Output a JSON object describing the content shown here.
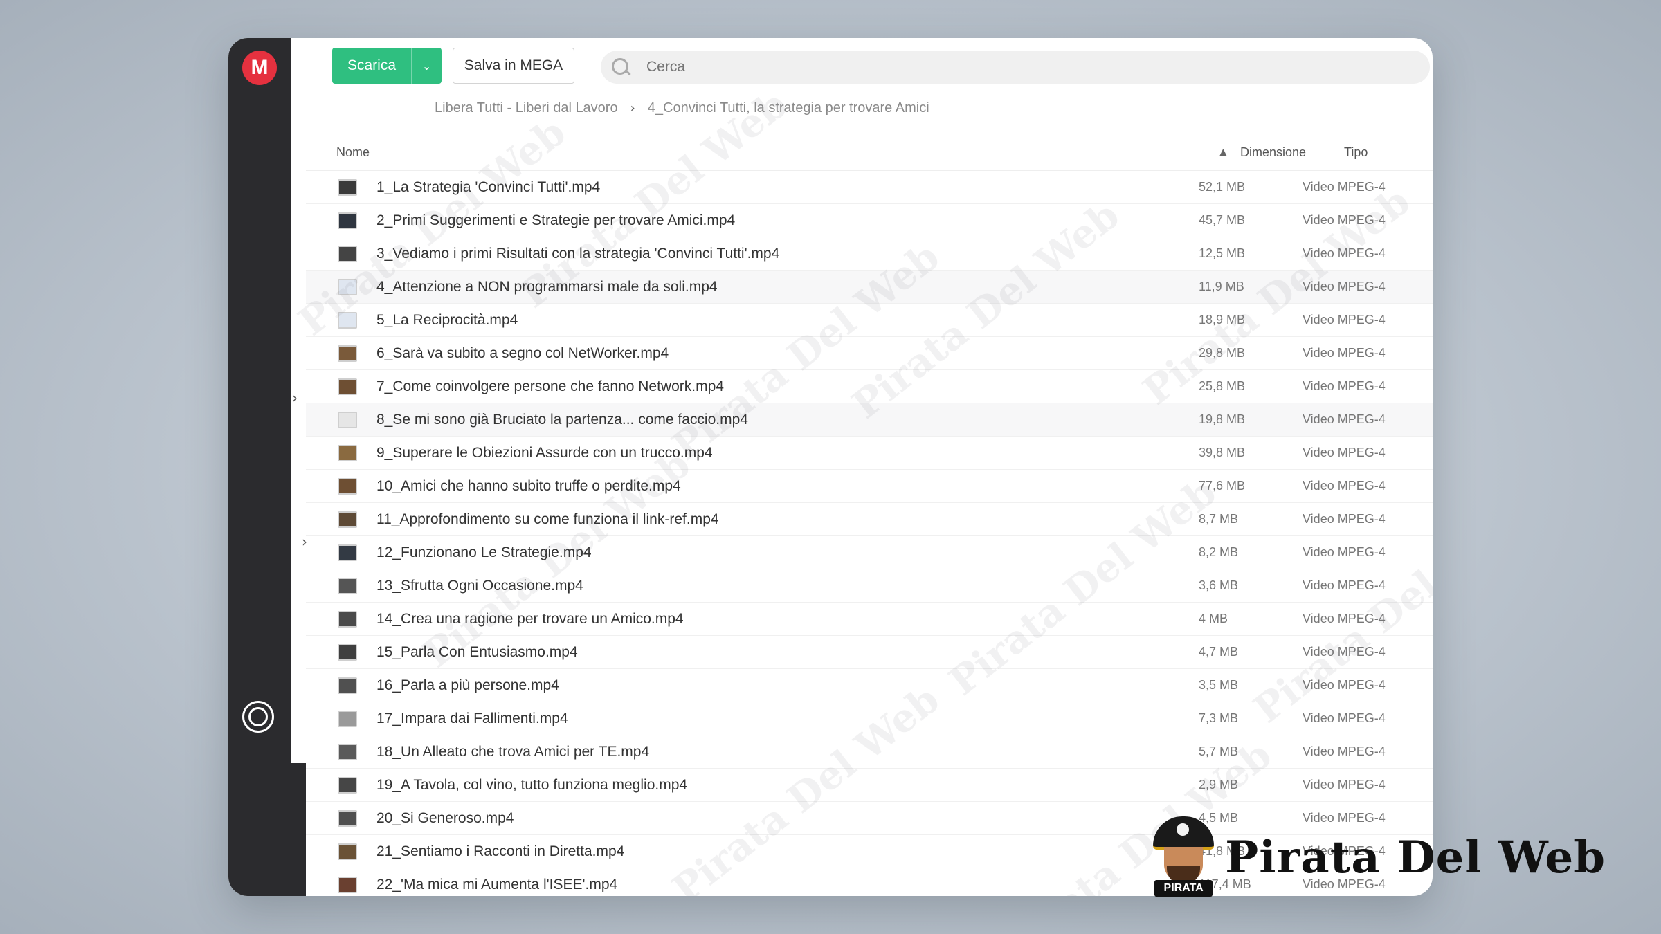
{
  "app": {
    "logo_letter": "M"
  },
  "toolbar": {
    "download_label": "Scarica",
    "save_label": "Salva in MEGA",
    "search_placeholder": "Cerca"
  },
  "breadcrumb": {
    "root": "Libera Tutti - Liberi dal Lavoro",
    "current": "4_Convinci Tutti, la strategia per trovare Amici"
  },
  "table": {
    "headers": {
      "name": "Nome",
      "size": "Dimensione",
      "type": "Tipo"
    },
    "rows": [
      {
        "name": "1_La Strategia 'Convinci Tutti'.mp4",
        "size": "52,1 MB",
        "type": "Video MPEG-4",
        "thumb": "#3a3a3a"
      },
      {
        "name": "2_Primi Suggerimenti e Strategie per trovare Amici.mp4",
        "size": "45,7 MB",
        "type": "Video MPEG-4",
        "thumb": "#2f3640"
      },
      {
        "name": "3_Vediamo i primi Risultati con la strategia 'Convinci Tutti'.mp4",
        "size": "12,5 MB",
        "type": "Video MPEG-4",
        "thumb": "#444444"
      },
      {
        "name": "4_Attenzione a NON programmarsi male da soli.mp4",
        "size": "11,9 MB",
        "type": "Video MPEG-4",
        "thumb": "#dfe6f0"
      },
      {
        "name": "5_La Reciprocità.mp4",
        "size": "18,9 MB",
        "type": "Video MPEG-4",
        "thumb": "#dfe6f0"
      },
      {
        "name": "6_Sarà va subito a segno col NetWorker.mp4",
        "size": "29,8 MB",
        "type": "Video MPEG-4",
        "thumb": "#7a5a3a"
      },
      {
        "name": "7_Come coinvolgere persone che fanno Network.mp4",
        "size": "25,8 MB",
        "type": "Video MPEG-4",
        "thumb": "#6e4f33"
      },
      {
        "name": "8_Se mi sono già Bruciato la partenza... come faccio.mp4",
        "size": "19,8 MB",
        "type": "Video MPEG-4",
        "thumb": "#e6e6e6"
      },
      {
        "name": "9_Superare le Obiezioni Assurde con un trucco.mp4",
        "size": "39,8 MB",
        "type": "Video MPEG-4",
        "thumb": "#8a6a40"
      },
      {
        "name": "10_Amici che hanno subito truffe o perdite.mp4",
        "size": "77,6 MB",
        "type": "Video MPEG-4",
        "thumb": "#6e4f33"
      },
      {
        "name": "11_Approfondimento su come funziona il link-ref.mp4",
        "size": "8,7 MB",
        "type": "Video MPEG-4",
        "thumb": "#5e4a36"
      },
      {
        "name": "12_Funzionano Le Strategie.mp4",
        "size": "8,2 MB",
        "type": "Video MPEG-4",
        "thumb": "#333a44"
      },
      {
        "name": "13_Sfrutta Ogni Occasione.mp4",
        "size": "3,6 MB",
        "type": "Video MPEG-4",
        "thumb": "#555555"
      },
      {
        "name": "14_Crea una ragione per trovare un Amico.mp4",
        "size": "4 MB",
        "type": "Video MPEG-4",
        "thumb": "#4a4a4a"
      },
      {
        "name": "15_Parla Con Entusiasmo.mp4",
        "size": "4,7 MB",
        "type": "Video MPEG-4",
        "thumb": "#3f3f3f"
      },
      {
        "name": "16_Parla a più persone.mp4",
        "size": "3,5 MB",
        "type": "Video MPEG-4",
        "thumb": "#505050"
      },
      {
        "name": "17_Impara dai Fallimenti.mp4",
        "size": "7,3 MB",
        "type": "Video MPEG-4",
        "thumb": "#9a9a9a"
      },
      {
        "name": "18_Un Alleato che trova Amici per TE.mp4",
        "size": "5,7 MB",
        "type": "Video MPEG-4",
        "thumb": "#5a5a5a"
      },
      {
        "name": "19_A Tavola, col vino, tutto funziona meglio.mp4",
        "size": "2,9 MB",
        "type": "Video MPEG-4",
        "thumb": "#464646"
      },
      {
        "name": "20_Si Generoso.mp4",
        "size": "4,5 MB",
        "type": "Video MPEG-4",
        "thumb": "#4f4f4f"
      },
      {
        "name": "21_Sentiamo i Racconti in Diretta.mp4",
        "size": "41,8 MB",
        "type": "Video MPEG-4",
        "thumb": "#6a5236"
      },
      {
        "name": "22_'Ma mica mi Aumenta l'ISEE'.mp4",
        "size": "117,4 MB",
        "type": "Video MPEG-4",
        "thumb": "#6a4030"
      }
    ]
  },
  "watermark": {
    "text": "Pirata Del Web",
    "badge": "PIRATA"
  },
  "colors": {
    "accent": "#2fbf80",
    "brand": "#e5313f",
    "sidebar": "#2b2b2e"
  }
}
